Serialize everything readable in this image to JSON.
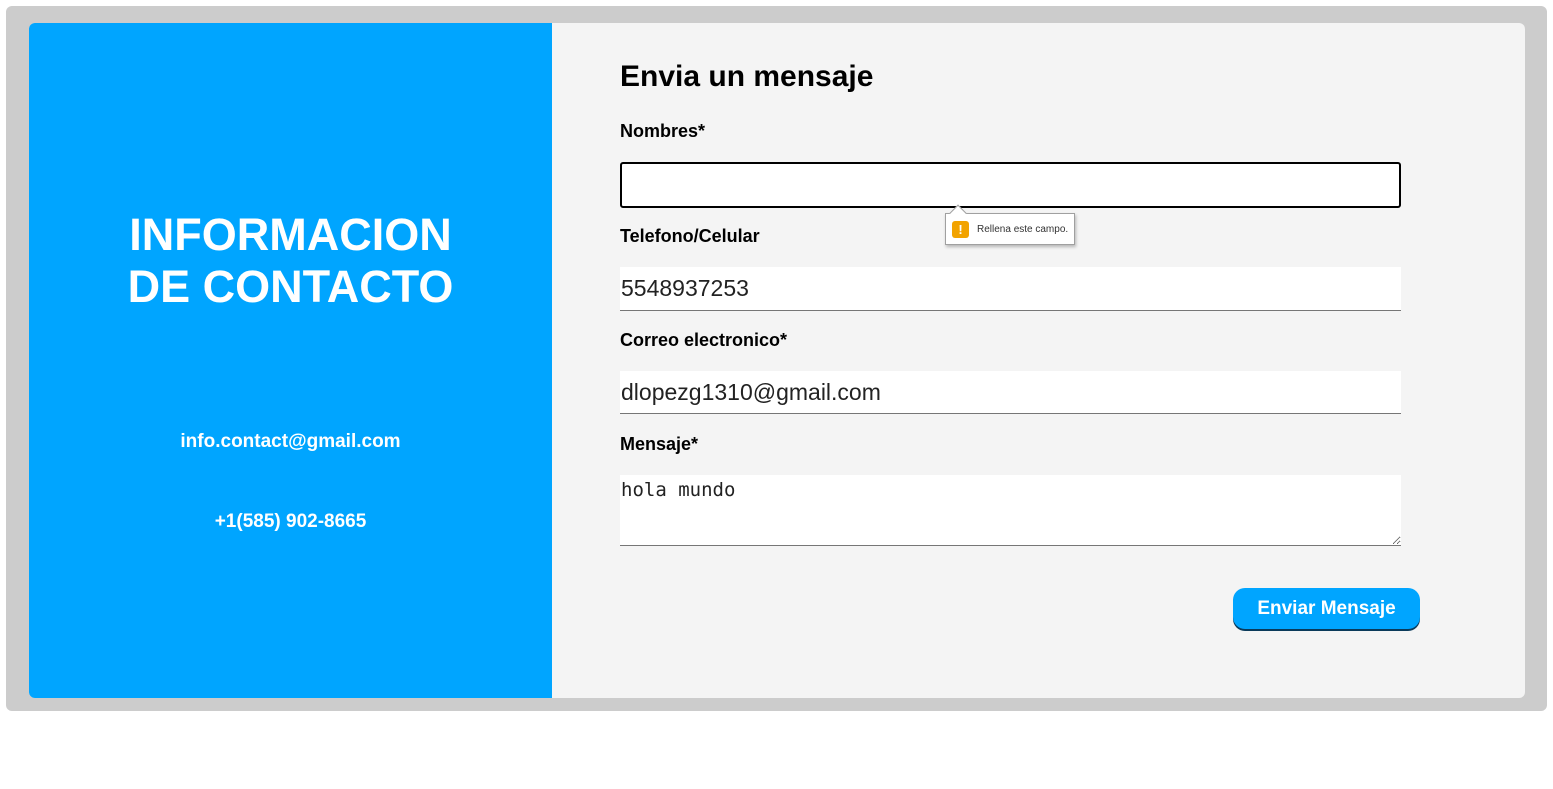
{
  "contact_info": {
    "title_line1": "INFORMACION",
    "title_line2": "DE CONTACTO",
    "email": "info.contact@gmail.com",
    "phone": "+1(585) 902-8665",
    "background_color": "#00a5ff"
  },
  "form": {
    "title": "Envia un mensaje",
    "name_label": "Nombres*",
    "name_value": "",
    "phone_label": "Telefono/Celular",
    "phone_value": "5548937253",
    "email_label": "Correo electronico*",
    "email_value": "dlopezg1310@gmail.com",
    "message_label": "Mensaje*",
    "message_value": "hola mundo",
    "submit_label": "Enviar Mensaje"
  },
  "validation_tooltip": {
    "icon": "warning-icon",
    "text": "Rellena este campo."
  },
  "colors": {
    "accent": "#00a5ff",
    "form_background": "#f4f4f4",
    "frame": "#cccccc",
    "warning": "#f2a300"
  }
}
